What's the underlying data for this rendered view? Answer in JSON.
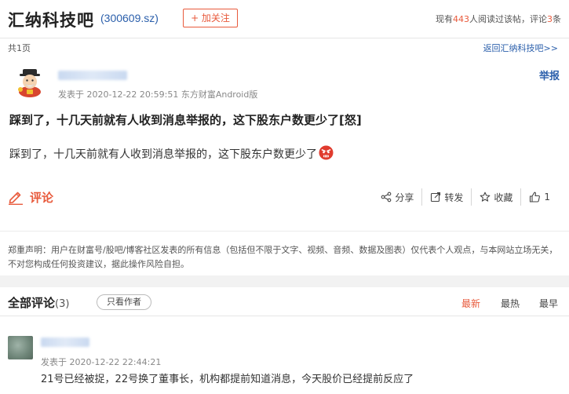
{
  "header": {
    "bar_title": "汇纳科技吧",
    "stock_code": "(300609.sz)",
    "follow_label": "+ 加关注",
    "stats": {
      "prefix": "现有",
      "readers": "443",
      "middle": "人阅读过该帖，评论",
      "comments": "3",
      "suffix": "条"
    }
  },
  "pager": {
    "page_count": "共1页",
    "back_link": "返回汇纳科技吧>>"
  },
  "post": {
    "meta": "发表于 2020-12-22 20:59:51 东方财富Android版",
    "report_label": "举报",
    "title": "踩到了，十几天前就有人收到消息举报的，这下股东户数更少了[怒]",
    "body": "踩到了，十几天前就有人收到消息举报的，这下股东户数更少了"
  },
  "actions": {
    "comment_label": "评论",
    "share_label": "分享",
    "repost_label": "转发",
    "favorite_label": "收藏",
    "like_count": "1"
  },
  "disclaimer": "郑重声明：用户在财富号/股吧/博客社区发表的所有信息（包括但不限于文字、视频、音频、数据及图表）仅代表个人观点，与本网站立场无关，不对您构成任何投资建议，据此操作风险自担。",
  "comments_section": {
    "title": "全部评论",
    "count": "(3)",
    "author_only_label": "只看作者",
    "sort_newest": "最新",
    "sort_hottest": "最热",
    "sort_earliest": "最早"
  },
  "comments": [
    {
      "meta": "发表于 2020-12-22 22:44:21",
      "text": "21号已经被捉，22号换了董事长，机构都提前知道消息，今天股价已经提前反应了"
    }
  ],
  "colors": {
    "accent": "#e85a3c",
    "link": "#2b5fab"
  }
}
